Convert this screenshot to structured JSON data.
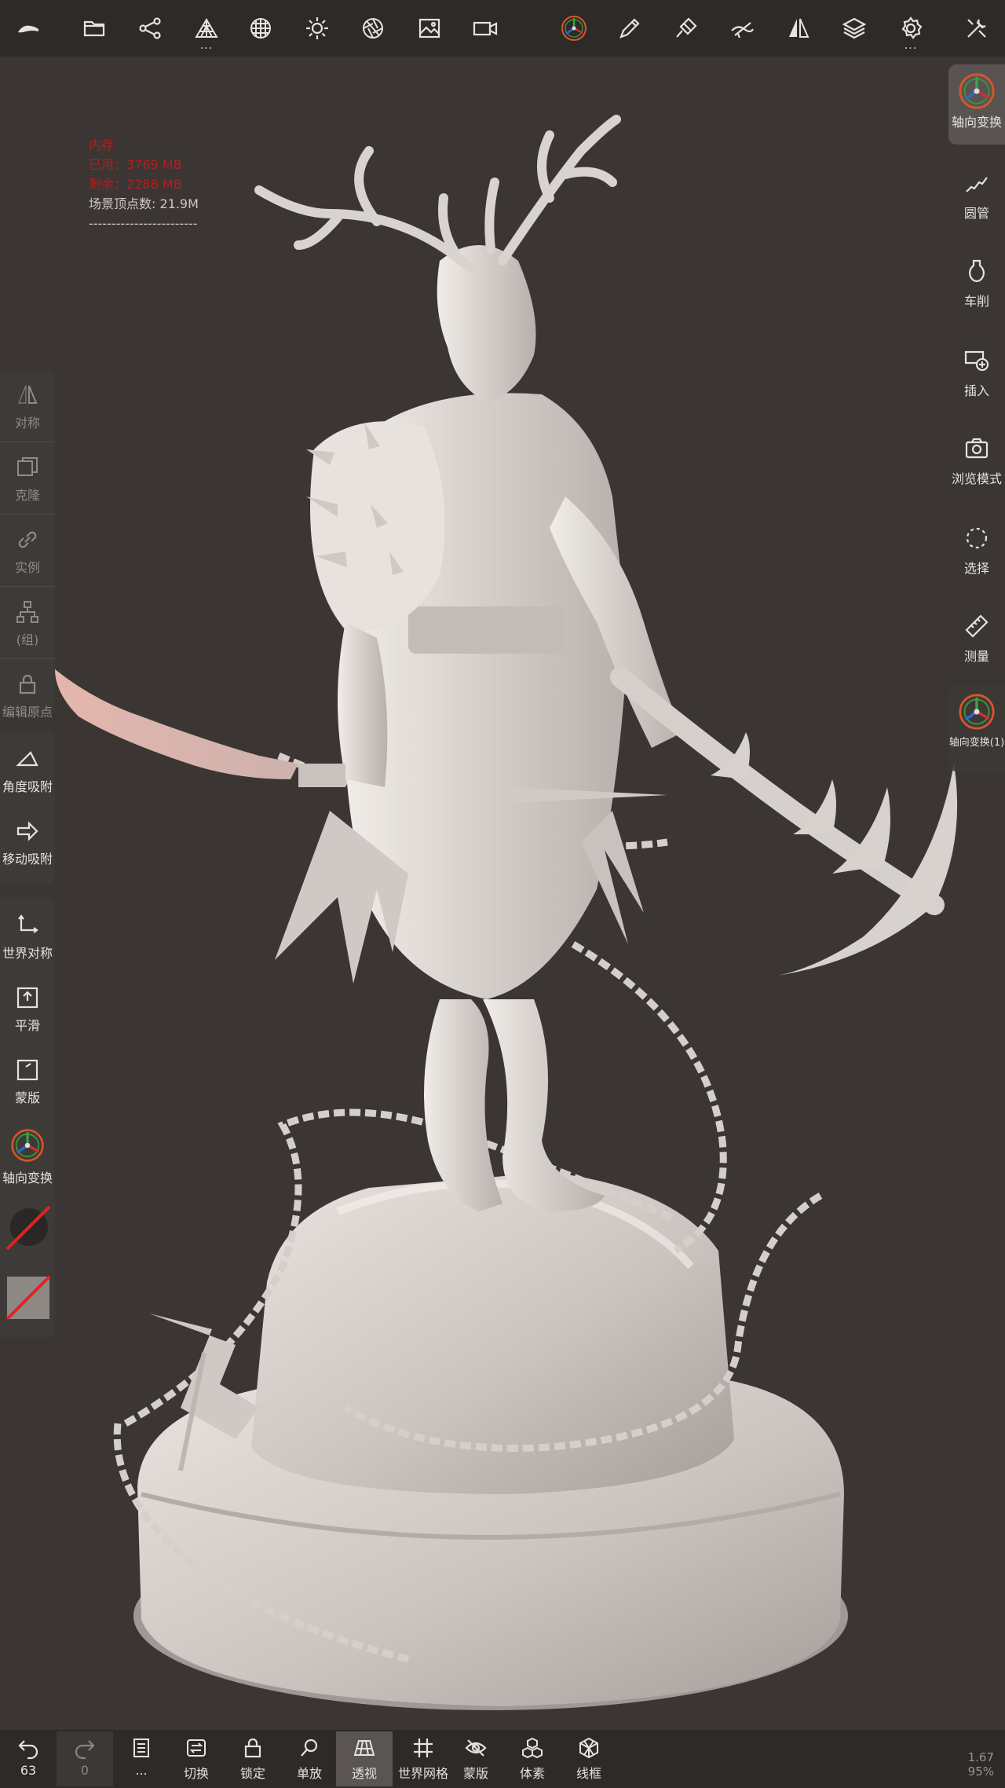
{
  "toolbar": {
    "items": [
      {
        "name": "app-logo",
        "icon": "logo-icon"
      },
      {
        "name": "files",
        "icon": "folder-icon"
      },
      {
        "name": "scene",
        "icon": "share-nodes-icon"
      },
      {
        "name": "topology",
        "icon": "topology-icon",
        "more": "..."
      },
      {
        "name": "material",
        "icon": "sphere-grid-icon"
      },
      {
        "name": "lighting",
        "icon": "sun-icon"
      },
      {
        "name": "camera-settings",
        "icon": "aperture-icon"
      },
      {
        "name": "background",
        "icon": "image-icon"
      },
      {
        "name": "record",
        "icon": "video-icon"
      },
      {
        "name": "gizmo",
        "icon": "gizmo-icon"
      },
      {
        "name": "brush",
        "icon": "pen-icon"
      },
      {
        "name": "paint",
        "icon": "paint-brush-icon"
      },
      {
        "name": "stroke",
        "icon": "stroke-icon"
      },
      {
        "name": "symmetry",
        "icon": "mirror-icon"
      },
      {
        "name": "layers",
        "icon": "layers-icon"
      },
      {
        "name": "settings",
        "icon": "gear-icon",
        "more": "..."
      },
      {
        "name": "tools",
        "icon": "tools-icon"
      }
    ]
  },
  "memory": {
    "title": "内存",
    "used": "已用：3769 MB",
    "free": "剩余：2288 MB",
    "vertices": "场景顶点数: 21.9M",
    "separator": "------------------------"
  },
  "left_panel": {
    "symmetry": "对称",
    "clone": "克隆",
    "instance": "实例",
    "group": "(组)",
    "edit_origin": "编辑原点",
    "angle_snap": "角度吸附",
    "move_snap": "移动吸附",
    "world_symmetry": "世界对称",
    "smooth": "平滑",
    "mask": "蒙版",
    "axis_transform": "轴向变换"
  },
  "right_panel": {
    "axis_transform": "轴向变换",
    "tube": "圆管",
    "lathe": "车削",
    "insert": "插入",
    "browse_mode": "浏览模式",
    "select": "选择",
    "measure": "测量",
    "axis_transform_1": "轴向变换(1)"
  },
  "bottom_bar": {
    "undo_count": "63",
    "redo_count": "0",
    "more": "...",
    "switch": "切换",
    "lock": "锁定",
    "single": "单放",
    "perspective": "透视",
    "world_grid": "世界网格",
    "mask": "蒙版",
    "voxel": "体素",
    "wireframe": "线框"
  },
  "zoom": {
    "line1": "1.67",
    "line2": "95%"
  },
  "colors": {
    "background": "#3b3634",
    "toolbar": "#2e2a28",
    "memory_warning": "#b01e1e",
    "model": "#d6d0cc"
  }
}
